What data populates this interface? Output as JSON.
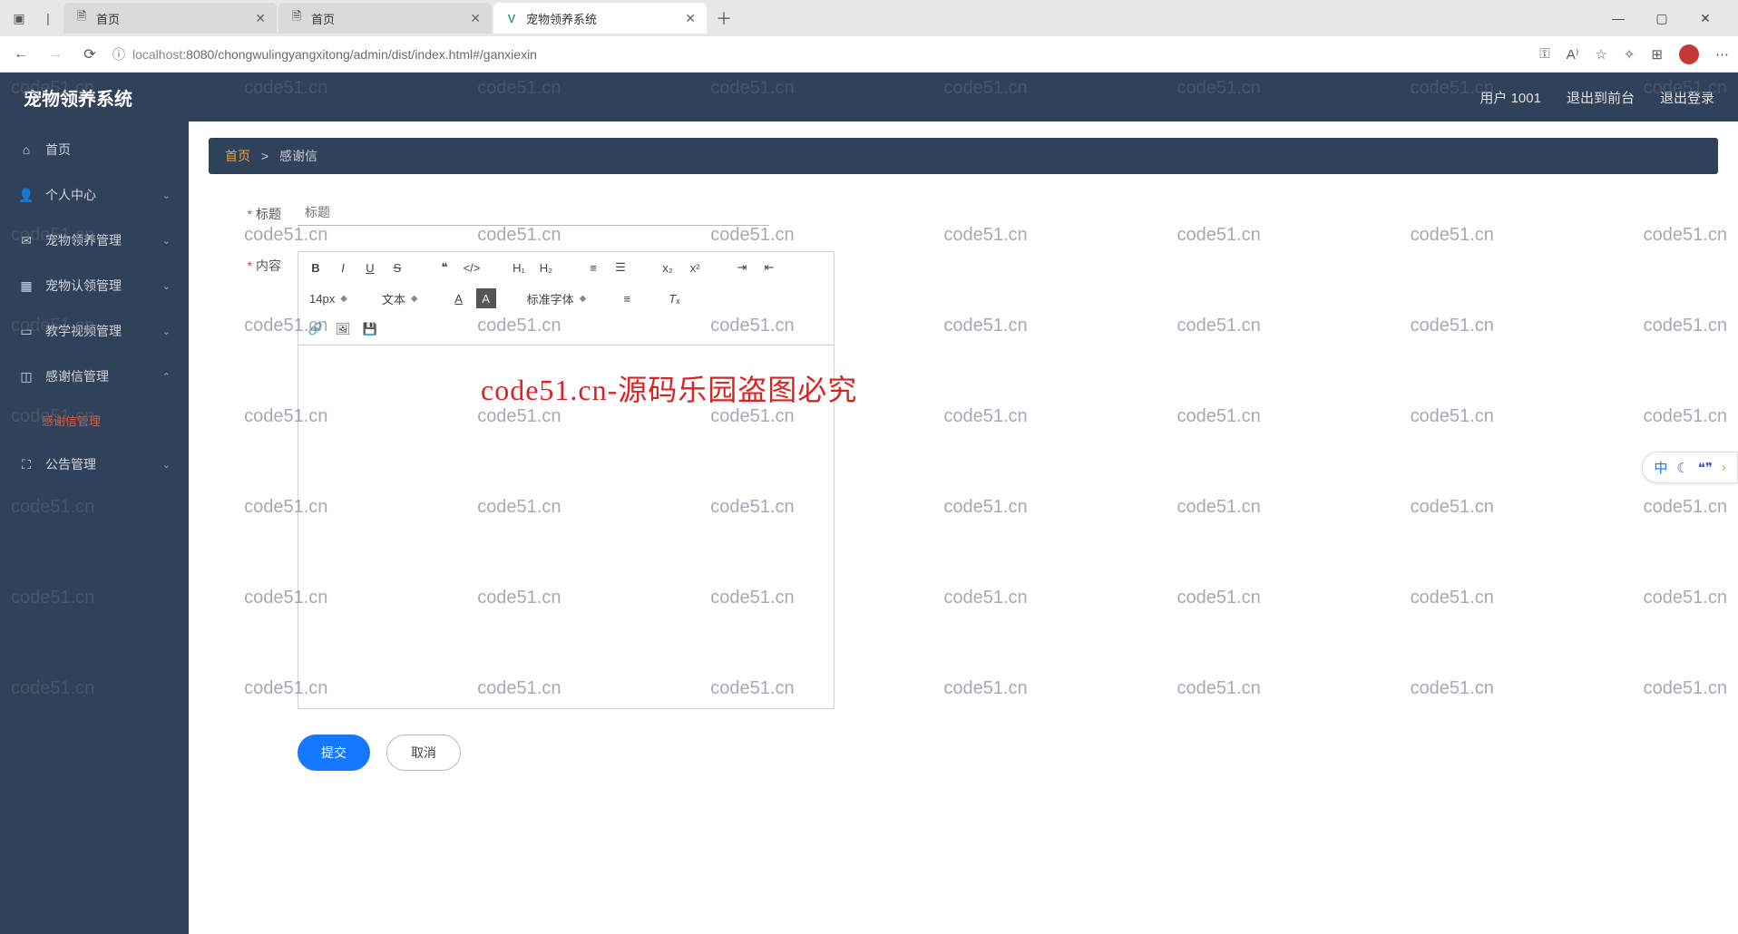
{
  "browser": {
    "tabs": [
      {
        "title": "首页",
        "active": false
      },
      {
        "title": "首页",
        "active": false
      },
      {
        "title": "宠物领养系统",
        "active": true
      }
    ],
    "url_host": "localhost",
    "url_path": ":8080/chongwulingyangxitong/admin/dist/index.html#/ganxiexin"
  },
  "app": {
    "title": "宠物领养系统",
    "user_label": "用户 1001",
    "to_front": "退出到前台",
    "logout": "退出登录"
  },
  "sidebar": {
    "items": [
      {
        "label": "首页",
        "icon": "home"
      },
      {
        "label": "个人中心",
        "icon": "user",
        "arrow": true
      },
      {
        "label": "宠物领养管理",
        "icon": "mail",
        "arrow": true
      },
      {
        "label": "宠物认领管理",
        "icon": "grid",
        "arrow": true
      },
      {
        "label": "教学视频管理",
        "icon": "video",
        "arrow": true
      },
      {
        "label": "感谢信管理",
        "icon": "crop",
        "arrow": true,
        "open": true
      },
      {
        "label": "公告管理",
        "icon": "expand",
        "arrow": true
      }
    ],
    "sub_active": "感谢信管理"
  },
  "breadcrumb": {
    "home": "首页",
    "current": "感谢信"
  },
  "form": {
    "title_label": "标题",
    "title_placeholder": "标题",
    "content_label": "内容",
    "submit": "提交",
    "cancel": "取消"
  },
  "editor": {
    "font_size": "14px",
    "text_style": "文本",
    "font_family": "标准字体"
  },
  "watermark": {
    "text": "code51.cn",
    "banner": "code51.cn-源码乐园盗图必究"
  },
  "side_widget": {
    "cn": "中"
  }
}
